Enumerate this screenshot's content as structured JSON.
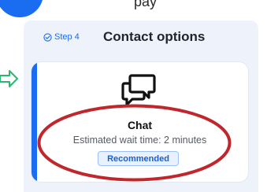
{
  "header": {
    "partial_text": "pay"
  },
  "step": {
    "badge_label": "Step 4",
    "badge_icon": "check-circle-icon",
    "title": "Contact options"
  },
  "option_card": {
    "icon": "chat-bubbles-icon",
    "title": "Chat",
    "description": "Estimated wait time: 2 minutes",
    "badge": "Recommended",
    "selected": true
  },
  "annotation": {
    "type": "highlight-oval",
    "color": "#c0272d"
  },
  "colors": {
    "accent": "#1a6cf0",
    "panel_bg": "#eef3fb",
    "annotation_red": "#c0272d",
    "arrow_green": "#2bb673"
  }
}
